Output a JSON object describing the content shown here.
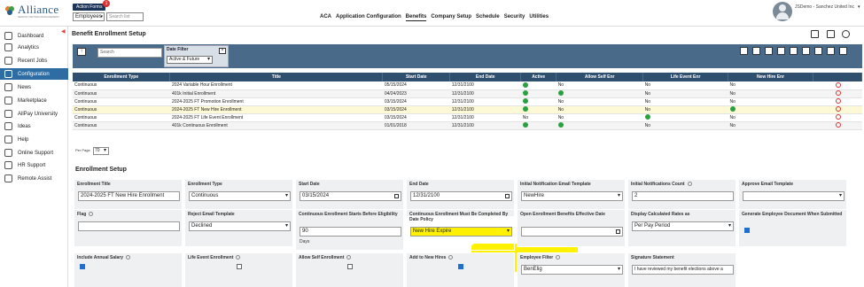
{
  "app": {
    "brand": "Alliance",
    "tagline": "SENIOR CENTER MANAGEMENT",
    "action_forms": "Action Forms",
    "badge": "1",
    "employee_select": "Employees",
    "search_placeholder": "Search list",
    "user_name": "JSDemo - Sanchez United Inc"
  },
  "nav": [
    "ACA",
    "Application Configuration",
    "Benefits",
    "Company Setup",
    "Schedule",
    "Security",
    "Utilities"
  ],
  "sidebar": [
    "Dashboard",
    "Analytics",
    "Recent Jobs",
    "Configuration",
    "News",
    "Marketplace",
    "AllPay University",
    "Ideas",
    "Help",
    "Online Support",
    "HR Support",
    "Remote Assist"
  ],
  "page": {
    "title": "Benefit Enrollment Setup",
    "search_placeholder": "Search",
    "date_filter_label": "Date Filter",
    "date_filter_value": "Active & Future",
    "per_page_label": "Per Page",
    "per_page_value": "70"
  },
  "table": {
    "headers": [
      "Enrollment Type",
      "Title",
      "Start Date",
      "End Date",
      "Active",
      "Allow Self Enr",
      "Life Event Enr",
      "New Hire Enr",
      ""
    ],
    "rows": [
      [
        "Continuous",
        "2024 Variable Hour Enrollment",
        "05/15/2024",
        "12/31/2100",
        "ok",
        "No",
        "No",
        "No",
        "del"
      ],
      [
        "Continuous",
        "401k Initial Enrollment",
        "04/24/2023",
        "12/31/2100",
        "ok",
        "ok",
        "No",
        "No",
        "del"
      ],
      [
        "Continuous",
        "2024-2025 FT Promotion Enrollment",
        "03/15/2024",
        "12/31/2100",
        "ok",
        "No",
        "No",
        "No",
        "del"
      ],
      [
        "Continuous",
        "2024-2025 FT New Hire Enrollment",
        "03/15/2024",
        "12/31/2100",
        "ok",
        "No",
        "No",
        "ok",
        "del"
      ],
      [
        "Continuous",
        "2024-2025 FT Life Event Enrollment",
        "03/15/2024",
        "12/31/2100",
        "No",
        "No",
        "ok",
        "No",
        "del"
      ],
      [
        "Continuous",
        "401k Continuous Enrollment",
        "01/01/2018",
        "12/31/2100",
        "ok",
        "ok",
        "No",
        "No",
        "del"
      ]
    ]
  },
  "setup": {
    "section_title": "Enrollment Setup",
    "enrollment_title_label": "Enrollment Title",
    "enrollment_title": "2024-2025 FT New Hire Enrollment",
    "enrollment_type_label": "Enrollment Type",
    "enrollment_type": "Continuous",
    "start_date_label": "Start Date",
    "start_date": "03/15/2024",
    "end_date_label": "End Date",
    "end_date": "12/31/2100",
    "init_email_label": "Initial Notification Email Template",
    "init_email": "NewHire",
    "init_count_label": "Initial Notifications Count",
    "init_count": "2",
    "approve_email_label": "Approve Email Template",
    "approve_email": "",
    "flag_label": "Flag",
    "flag": "",
    "reject_email_label": "Reject Email Template",
    "reject_email": "Declined",
    "starts_before_label": "Continuous Enrollment Starts Before Eligibility",
    "starts_before": "90",
    "days": "Days",
    "completed_by_label": "Continuous Enrollment Must Be Completed By Date Policy",
    "completed_by": "New Hire Expire",
    "open_eff_label": "Open Enrollment Benefits Effective Date",
    "open_eff": "",
    "rates_label": "Display Calculated Rates as",
    "rates": "Per Pay Period",
    "gen_doc_label": "Generate Employee Document When Submitted",
    "salary_label": "Include Annual Salary",
    "life_label": "Life Event Enrollment",
    "self_label": "Allow Self Enrollment",
    "newhire_label": "Add to New Hires",
    "emp_filter_label": "Employee Filter",
    "emp_filter": "BenElig",
    "sig_label": "Signature Statement",
    "sig": "I have reviewed my benefit elections above a"
  },
  "colors": {
    "accent": "#2e6da4",
    "header": "#2f4f6f",
    "toolbar": "#4a6a8a",
    "highlight": "#fff100",
    "check": "#1e6fd0"
  }
}
